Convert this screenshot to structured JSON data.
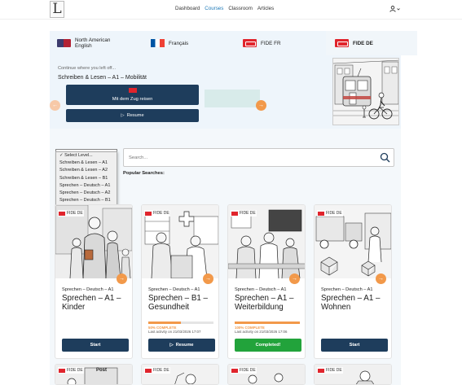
{
  "nav": {
    "logo_letter": "L",
    "links": [
      "Dashboard",
      "Courses",
      "Classroom",
      "Articles"
    ],
    "active_link": "Courses"
  },
  "language_tabs": [
    {
      "label": "North American English",
      "line1": "North American",
      "line2": "English",
      "flag": "flag-us"
    },
    {
      "label": "Français",
      "flag": "flag-fr"
    },
    {
      "label": "FIDE FR",
      "flag": "flag-fide"
    },
    {
      "label": "FIDE DE",
      "flag": "flag-fide",
      "selected": true
    }
  ],
  "continue": {
    "label": "Continue where you left off...",
    "course_title": "Schreiben & Lesen – A1 – Mobilität",
    "lesson": "Mit dem Zug reisen",
    "resume_label": "Resume"
  },
  "level_select": {
    "options": [
      "Select Level...",
      "Schreiben & Lesen – A1",
      "Schreiben & Lesen – A2",
      "Schreiben & Lesen – B1",
      "Sprechen – Deutsch – A1",
      "Sprechen – Deutsch – A2",
      "Sprechen – Deutsch – B1"
    ],
    "selected": "Select Level..."
  },
  "search": {
    "placeholder": "Search..."
  },
  "popular_label": "Popular Searches:",
  "courses": [
    {
      "badge": "FIDE DE",
      "category": "Sprechen – Deutsch – A1",
      "title": "Sprechen – A1 – Kinder",
      "button": "Start",
      "button_style": "dark"
    },
    {
      "badge": "FIDE DE",
      "category": "Sprechen – Deutsch – A1",
      "title": "Sprechen – B1 – Gesundheit",
      "progress_label": "50% COMPLETE",
      "progress": 0.5,
      "last_activity": "Last activity on 21/03/2026 17:07",
      "button": "Resume",
      "button_style": "dark"
    },
    {
      "badge": "FIDE DE",
      "category": "Sprechen – Deutsch – A1",
      "title": "Sprechen – A1 – Weiterbildung",
      "progress_label": "100% COMPLETE",
      "progress": 1.0,
      "last_activity": "Last activity on 21/03/2026 17:06",
      "button": "Completed!",
      "button_style": "green"
    },
    {
      "badge": "FIDE DE",
      "category": "Sprechen – Deutsch – A1",
      "title": "Sprechen – A1 – Wohnen",
      "button": "Start",
      "button_style": "dark"
    }
  ],
  "row2_badges": [
    "FIDE DE",
    "FIDE DE",
    "FIDE DE",
    "FIDE DE"
  ],
  "row2_sign": "Post",
  "colors": {
    "accent": "#1f7ab8",
    "navy": "#1e3d5c",
    "orange": "#f2994a",
    "green": "#22a33b",
    "fide_red": "#e0242c"
  }
}
